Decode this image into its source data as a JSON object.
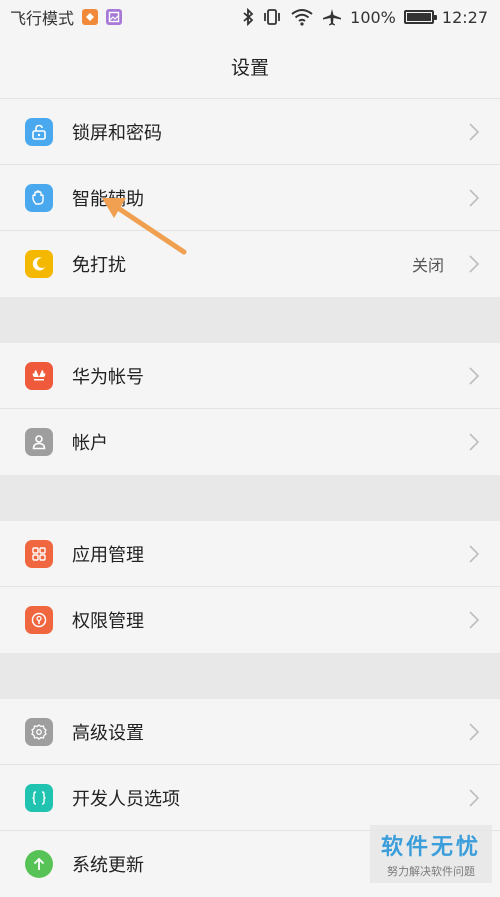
{
  "status_bar": {
    "mode_text": "飞行模式",
    "battery_percent": "100%",
    "time": "12:27",
    "battery_level": 1.0,
    "icons": [
      "notification-app-icon",
      "notification-gallery-icon",
      "bluetooth-icon",
      "vibrate-icon",
      "wifi-icon",
      "airplane-icon",
      "battery-icon"
    ]
  },
  "title": "设置",
  "groups": [
    {
      "items": [
        {
          "label": "锁屏和密码",
          "icon": "lock-icon",
          "color": "#4aa8ef"
        },
        {
          "label": "智能辅助",
          "icon": "hand-icon",
          "color": "#4aa8ef"
        },
        {
          "label": "免打扰",
          "icon": "moon-icon",
          "color": "#f5b800",
          "value": "关闭"
        }
      ]
    },
    {
      "items": [
        {
          "label": "华为帐号",
          "icon": "huawei-logo-icon",
          "color": "#f05a3c"
        },
        {
          "label": "帐户",
          "icon": "person-icon",
          "color": "#9e9e9e"
        }
      ]
    },
    {
      "items": [
        {
          "label": "应用管理",
          "icon": "apps-grid-icon",
          "color": "#f0663f"
        },
        {
          "label": "权限管理",
          "icon": "permission-icon",
          "color": "#f0663f"
        }
      ]
    },
    {
      "items": [
        {
          "label": "高级设置",
          "icon": "gear-icon",
          "color": "#9e9e9e"
        },
        {
          "label": "开发人员选项",
          "icon": "braces-icon",
          "color": "#1fc3b0"
        },
        {
          "label": "系统更新",
          "icon": "update-arrow-icon",
          "color": "#57c255"
        }
      ]
    }
  ],
  "annotation": {
    "arrow_color": "#f0a050"
  },
  "watermark": {
    "title": "软件无忧",
    "subtitle": "努力解决软件问题"
  }
}
